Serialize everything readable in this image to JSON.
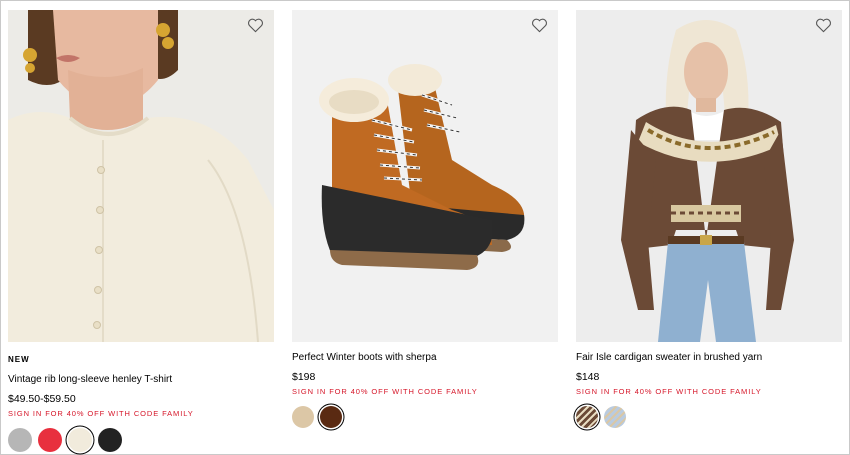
{
  "products": [
    {
      "badge": "NEW",
      "name": "Vintage rib long-sleeve henley T-shirt",
      "price": "$49.50-$59.50",
      "promo": "SIGN IN FOR 40% OFF WITH CODE FAMILY",
      "image_subject": "cream-henley-tshirt",
      "swatches": [
        {
          "color": "#b6b6b6",
          "selected": false
        },
        {
          "color": "#e8303e",
          "selected": false
        },
        {
          "color": "#f1ebdc",
          "selected": true
        },
        {
          "color": "#222222",
          "selected": false
        }
      ]
    },
    {
      "badge": "",
      "name": "Perfect Winter boots with sherpa",
      "price": "$198",
      "promo": "SIGN IN FOR 40% OFF WITH CODE FAMILY",
      "image_subject": "winter-boots",
      "swatches": [
        {
          "color": "#dcc7a6",
          "selected": false
        },
        {
          "color": "#5a2a12",
          "selected": true
        }
      ]
    },
    {
      "badge": "",
      "name": "Fair Isle cardigan sweater in brushed yarn",
      "price": "$148",
      "promo": "SIGN IN FOR 40% OFF WITH CODE FAMILY",
      "image_subject": "fair-isle-cardigan",
      "swatches": [
        {
          "color": "#6b4a36",
          "selected": true
        },
        {
          "color": "#b9cbe0",
          "selected": false
        }
      ]
    }
  ],
  "icons": {
    "wishlist": "heart-icon"
  },
  "colors": {
    "promo": "#d6172a",
    "text": "#000000",
    "image_bg": "#f2f2f2"
  }
}
